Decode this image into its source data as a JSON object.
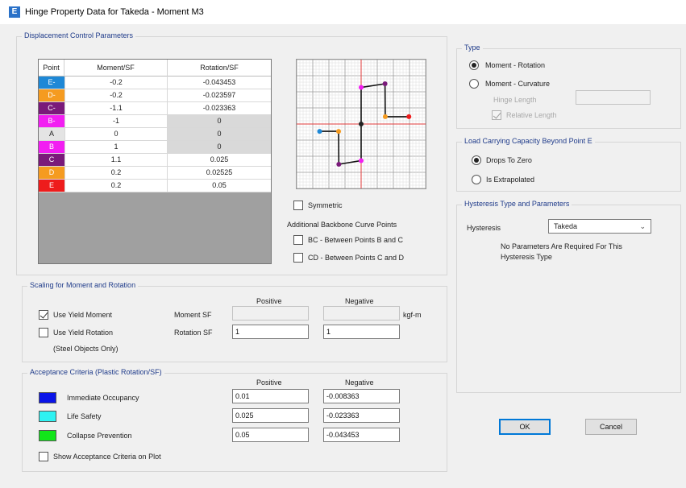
{
  "window": {
    "title": "Hinge Property Data for Takeda - Moment M3",
    "icon_letter": "E"
  },
  "displacement": {
    "group_title": "Displacement Control Parameters",
    "columns": [
      "Point",
      "Moment/SF",
      "Rotation/SF"
    ],
    "rows": [
      {
        "point": "E-",
        "moment": "-0.2",
        "rotation": "-0.043453",
        "color": "#1e88d6",
        "grey": false
      },
      {
        "point": "D-",
        "moment": "-0.2",
        "rotation": "-0.023597",
        "color": "#f59b20",
        "grey": false
      },
      {
        "point": "C-",
        "moment": "-1.1",
        "rotation": "-0.023363",
        "color": "#7a1a7a",
        "grey": false
      },
      {
        "point": "B-",
        "moment": "-1",
        "rotation": "0",
        "color": "#f21ef2",
        "grey": true
      },
      {
        "point": "A",
        "moment": "0",
        "rotation": "0",
        "color": "#e4e4e4",
        "grey": true
      },
      {
        "point": "B",
        "moment": "1",
        "rotation": "0",
        "color": "#f21ef2",
        "grey": true
      },
      {
        "point": "C",
        "moment": "1.1",
        "rotation": "0.025",
        "color": "#7a1a7a",
        "grey": false
      },
      {
        "point": "D",
        "moment": "0.2",
        "rotation": "0.02525",
        "color": "#f59b20",
        "grey": false
      },
      {
        "point": "E",
        "moment": "0.2",
        "rotation": "0.05",
        "color": "#ee1c1c",
        "grey": false
      }
    ],
    "symmetric_label": "Symmetric",
    "additional_label": "Additional Backbone Curve Points",
    "bc_label": "BC - Between Points B and C",
    "cd_label": "CD - Between Points C and D"
  },
  "type": {
    "group_title": "Type",
    "moment_rotation": "Moment - Rotation",
    "moment_curvature": "Moment - Curvature",
    "hinge_length": "Hinge Length",
    "relative_length": "Relative Length"
  },
  "load": {
    "group_title": "Load Carrying Capacity Beyond Point E",
    "drops_to_zero": "Drops To Zero",
    "is_extrapolated": "Is Extrapolated"
  },
  "hysteresis": {
    "group_title": "Hysteresis Type and Parameters",
    "label": "Hysteresis",
    "value": "Takeda",
    "note_line1": "No Parameters Are Required For This",
    "note_line2": "Hysteresis Type"
  },
  "scaling": {
    "group_title": "Scaling for Moment and Rotation",
    "positive": "Positive",
    "negative": "Negative",
    "use_yield_moment": "Use Yield Moment",
    "use_yield_rotation": "Use Yield Rotation",
    "steel_only": "(Steel Objects Only)",
    "moment_sf": "Moment SF",
    "rotation_sf": "Rotation SF",
    "moment_pos": "",
    "moment_neg": "",
    "rotation_pos": "1",
    "rotation_neg": "1",
    "unit": "kgf-m"
  },
  "acceptance": {
    "group_title": "Acceptance Criteria (Plastic Rotation/SF)",
    "positive": "Positive",
    "negative": "Negative",
    "rows": [
      {
        "label": "Immediate Occupancy",
        "color": "#0a14e8",
        "pos": "0.01",
        "neg": "-0.008363"
      },
      {
        "label": "Life Safety",
        "color": "#2ef2f2",
        "pos": "0.025",
        "neg": "-0.023363"
      },
      {
        "label": "Collapse Prevention",
        "color": "#12e61a",
        "pos": "0.05",
        "neg": "-0.043453"
      }
    ],
    "show_on_plot": "Show Acceptance Criteria on Plot"
  },
  "buttons": {
    "ok": "OK",
    "cancel": "Cancel"
  }
}
